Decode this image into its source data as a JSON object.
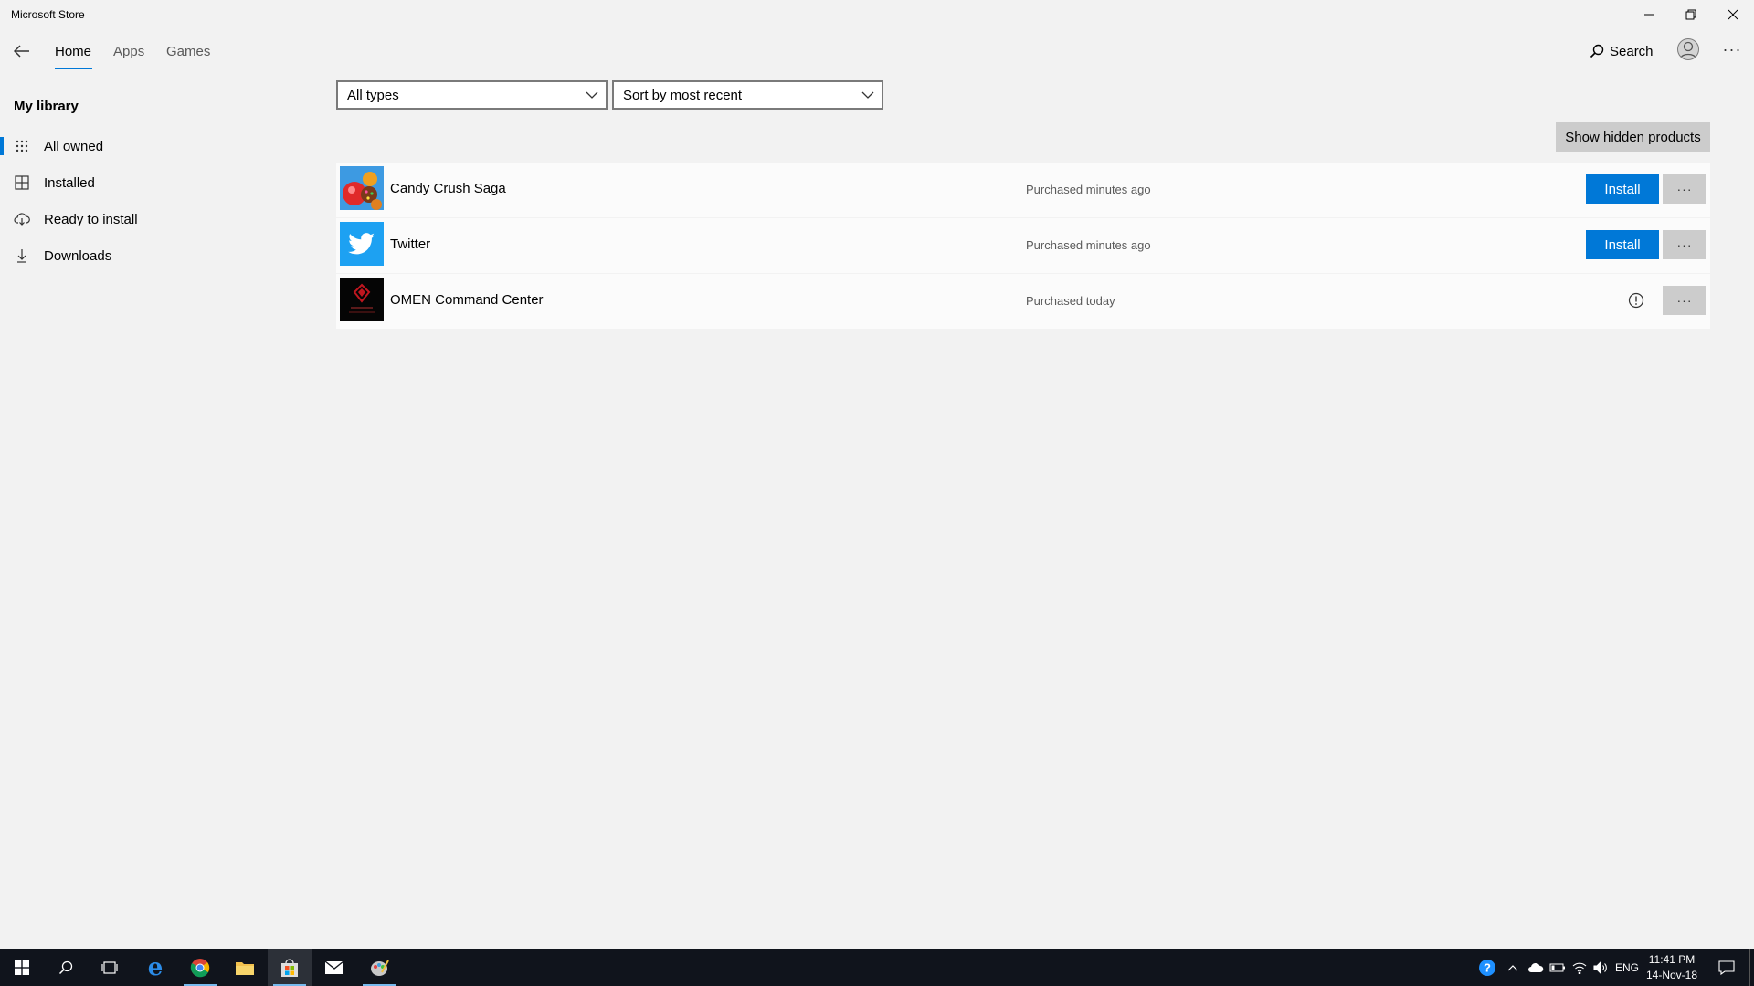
{
  "window": {
    "title": "Microsoft Store"
  },
  "nav": {
    "tabs": [
      {
        "label": "Home",
        "active": true
      },
      {
        "label": "Apps",
        "active": false
      },
      {
        "label": "Games",
        "active": false
      }
    ],
    "search_label": "Search",
    "more_label": "···"
  },
  "sidebar": {
    "title": "My library",
    "items": [
      {
        "label": "All owned",
        "icon": "grid-dots-icon",
        "selected": true
      },
      {
        "label": "Installed",
        "icon": "installed-grid-icon",
        "selected": false
      },
      {
        "label": "Ready to install",
        "icon": "cloud-download-icon",
        "selected": false
      },
      {
        "label": "Downloads",
        "icon": "download-arrow-icon",
        "selected": false
      }
    ]
  },
  "filters": {
    "type_value": "All types",
    "sort_value": "Sort by most recent",
    "show_hidden_label": "Show hidden products"
  },
  "products": [
    {
      "name": "Candy Crush Saga",
      "status": "Purchased minutes ago",
      "action": "Install",
      "more": "···"
    },
    {
      "name": "Twitter",
      "status": "Purchased minutes ago",
      "action": "Install",
      "more": "···"
    },
    {
      "name": "OMEN Command Center",
      "status": "Purchased today",
      "more": "···"
    }
  ],
  "taskbar": {
    "tray_lang": "ENG",
    "time": "11:41 PM",
    "date": "14-Nov-18"
  },
  "colors": {
    "accent": "#0078d7",
    "background": "#f2f2f2",
    "taskbar": "#10141c"
  }
}
